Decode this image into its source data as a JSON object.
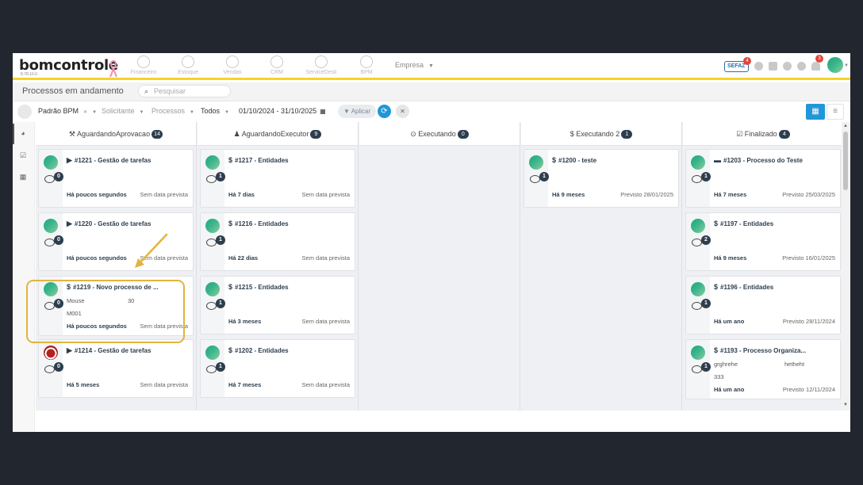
{
  "app": {
    "logo": "bomcontrole",
    "version": "8.78.10.0"
  },
  "topnav": {
    "modules": [
      {
        "label": "Financeiro",
        "icon": "dollar-icon"
      },
      {
        "label": "Estoque",
        "icon": "box-icon"
      },
      {
        "label": "Vendas",
        "icon": "cart-icon"
      },
      {
        "label": "CRM",
        "icon": "target-icon"
      },
      {
        "label": "ServiceDesk",
        "icon": "headset-icon"
      },
      {
        "label": "BPM",
        "icon": "workflow-icon"
      }
    ],
    "empresa_label": "Empresa",
    "sefaz_label": "SEFAZ",
    "sefaz_badge": "4",
    "notification_badge": "3"
  },
  "subheader": {
    "page_title": "Processos em andamento",
    "search_placeholder": "Pesquisar"
  },
  "filters": {
    "template": "Padrão BPM",
    "solicitante": "Solicitante",
    "processos": "Processos",
    "status": "Todos",
    "date_range": "01/10/2024 - 31/10/2025",
    "apply_label": "Aplicar"
  },
  "columns": [
    {
      "title": "AguardandoAprovacao",
      "count": "14",
      "cards": [
        {
          "type": "play",
          "title": "#1221 - Gestão de tarefas",
          "comments": "0",
          "time": "Há poucos segundos",
          "due": "Sem data prevista"
        },
        {
          "type": "play",
          "title": "#1220 - Gestão de tarefas",
          "comments": "0",
          "time": "Há poucos segundos",
          "due": "Sem data prevista"
        },
        {
          "type": "dollar",
          "title": "#1219 - Novo processo de ...",
          "comments": "0",
          "time": "Há poucos segundos",
          "due": "Sem data prevista",
          "field1_label": "Mouse",
          "field1_value": "30",
          "field2_label": "M001"
        },
        {
          "type": "play",
          "title": "#1214 - Gestão de tarefas",
          "comments": "0",
          "time": "Há 5 meses",
          "due": "Sem data prevista"
        }
      ]
    },
    {
      "title": "AguardandoExecutor",
      "count": "9",
      "cards": [
        {
          "type": "dollar",
          "title": "#1217 - Entidades",
          "comments": "1",
          "time": "Há 7 dias",
          "due": "Sem data prevista"
        },
        {
          "type": "dollar",
          "title": "#1216 - Entidades",
          "comments": "1",
          "time": "Há 22 dias",
          "due": "Sem data prevista"
        },
        {
          "type": "dollar",
          "title": "#1215 - Entidades",
          "comments": "1",
          "time": "Há 3 meses",
          "due": "Sem data prevista"
        },
        {
          "type": "dollar",
          "title": "#1202 - Entidades",
          "comments": "1",
          "time": "Há 7 meses",
          "due": "Sem data prevista"
        }
      ]
    },
    {
      "title": "Executando",
      "count": "0",
      "cards": []
    },
    {
      "title": "Executando 2",
      "count": "1",
      "cards": [
        {
          "type": "dollar",
          "title": "#1200 - teste",
          "comments": "1",
          "time": "Há 9 meses",
          "due": "Previsto 28/01/2025"
        }
      ]
    },
    {
      "title": "Finalizado",
      "count": "4",
      "cards": [
        {
          "type": "battery",
          "title": "#1203 - Processo do Teste",
          "comments": "1",
          "time": "Há 7 meses",
          "due": "Previsto 25/03/2025"
        },
        {
          "type": "dollar",
          "title": "#1197 - Entidades",
          "comments": "2",
          "time": "Há 9 meses",
          "due": "Previsto 16/01/2025"
        },
        {
          "type": "dollar",
          "title": "#1196 - Entidades",
          "comments": "1",
          "time": "Há um ano",
          "due": "Previsto 28/11/2024"
        },
        {
          "type": "dollar",
          "title": "#1193 - Processo Organiza...",
          "comments": "1",
          "time": "Há um ano",
          "due": "Previsto 12/11/2024",
          "field1_label": "grghrehe",
          "field1_value": "hetheht",
          "field2_label": "333"
        }
      ]
    }
  ]
}
